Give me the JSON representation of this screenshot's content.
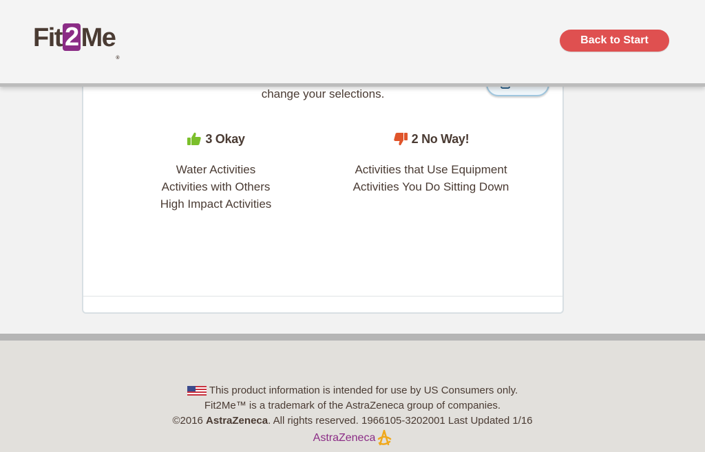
{
  "header": {
    "logo_text_pre": "Fit",
    "logo_text_two": "2",
    "logo_text_post": "Me",
    "logo_tm": "®",
    "back_button_label": "Back to Start"
  },
  "summary": {
    "intro_line1": "",
    "intro_line2": "change your selections.",
    "edit_label": "Edit",
    "okay": {
      "heading": "3 Okay",
      "items": [
        "Water Activities",
        "Activities with Others",
        "High Impact Activities"
      ]
    },
    "noway": {
      "heading": "2 No Way!",
      "items": [
        "Activities that Use Equipment",
        "Activities You Do Sitting Down"
      ]
    }
  },
  "footer": {
    "line1": "This product information is intended for use by US Consumers only.",
    "line2": "Fit2Me™ is a trademark of the AstraZeneca group of companies.",
    "line3_pre": "©2016 ",
    "line3_brand": "AstraZeneca",
    "line3_post": ". All rights reserved. 1966105-3202001 Last Updated 1/16",
    "brand_logo_text": "AstraZeneca"
  },
  "colors": {
    "accent_red": "#df5050",
    "brand_purple": "#8b2c86",
    "thumb_up_green": "#7bbf2b",
    "thumb_down_orange": "#e0552b"
  },
  "icons": {
    "okay": "thumbs-up-icon",
    "noway": "thumbs-down-icon",
    "flag": "us-flag-icon",
    "edit": "pencil-icon"
  }
}
